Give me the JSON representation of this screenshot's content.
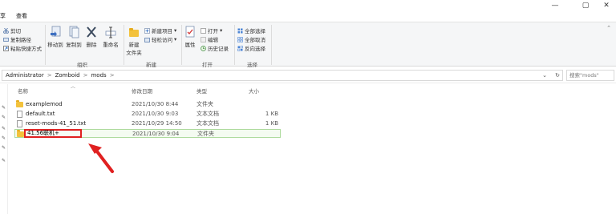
{
  "menu": {
    "item1": "享",
    "item2": "查看"
  },
  "window": {
    "minimize": "—",
    "maximize": "▢",
    "close": "✕"
  },
  "ribbon": {
    "clipboard": {
      "cut": "剪切",
      "copy_path": "复制路径",
      "paste_shortcut": "粘贴快捷方式"
    },
    "organize": {
      "move_to": "移动到",
      "copy_to": "复制到",
      "delete": "删除",
      "rename": "重命名",
      "label": "组织"
    },
    "new": {
      "new_item": "新建项目",
      "easy_access": "轻松访问",
      "new_folder_line1": "新建",
      "new_folder_line2": "文件夹",
      "label": "新建"
    },
    "open": {
      "properties": "属性",
      "open": "打开",
      "edit": "编辑",
      "history": "历史记录",
      "label": "打开"
    },
    "select": {
      "select_all": "全部选择",
      "select_none": "全部取消",
      "invert": "反向选择",
      "label": "选择"
    }
  },
  "address": {
    "path": [
      "Administrator",
      "Zomboid",
      "mods"
    ],
    "separator": ">",
    "search_placeholder": "搜索\"mods\""
  },
  "columns": {
    "name": "名称",
    "date": "修改日期",
    "type": "类型",
    "size": "大小"
  },
  "files": [
    {
      "name": "examplemod",
      "date": "2021/10/30 8:44",
      "type": "文件夹",
      "size": ""
    },
    {
      "name": "default.txt",
      "date": "2021/10/30 9:03",
      "type": "文本文档",
      "size": "1 KB"
    },
    {
      "name": "reset-mods-41_51.txt",
      "date": "2021/10/29 14:50",
      "type": "文本文档",
      "size": "1 KB"
    },
    {
      "name": "",
      "date": "2021/10/30 9:04",
      "type": "文件夹",
      "size": ""
    }
  ],
  "rename_value": "41.56联机+",
  "colors": {
    "annotation": "#e02020",
    "folder": "#f3c23c",
    "selection_border": "#aedb9e"
  }
}
